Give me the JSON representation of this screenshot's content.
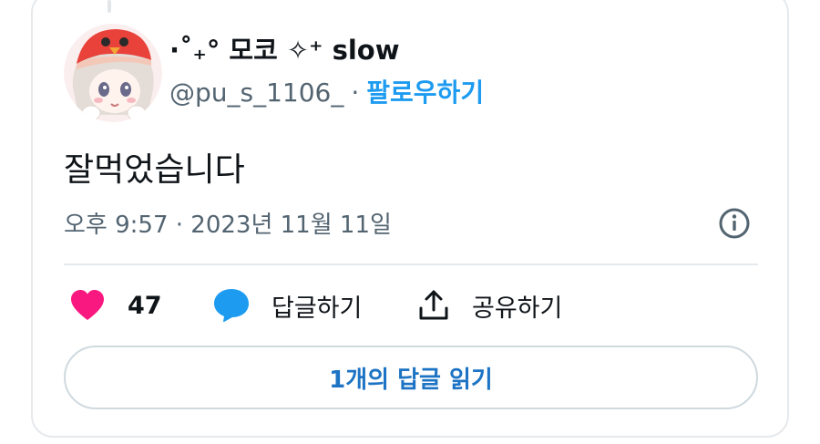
{
  "author": {
    "display_name": "·˚₊° 모코 ✧⁺ slow",
    "handle": "@pu_s_1106_",
    "separator": "·",
    "follow_label": "팔로우하기"
  },
  "tweet": {
    "text": "잘먹었습니다",
    "timestamp": "오후 9:57 · 2023년 11월 11일"
  },
  "actions": {
    "like_count": "47",
    "reply_label": "답글하기",
    "share_label": "공유하기"
  },
  "read_replies_label": "1개의 답글 읽기",
  "colors": {
    "accent": "#1d9bf0",
    "like": "#f91880",
    "text": "#0f1419",
    "secondary": "#536471",
    "border": "#e6e9ec"
  },
  "icons": [
    "info-icon",
    "heart-icon",
    "reply-bubble-icon",
    "share-icon"
  ]
}
